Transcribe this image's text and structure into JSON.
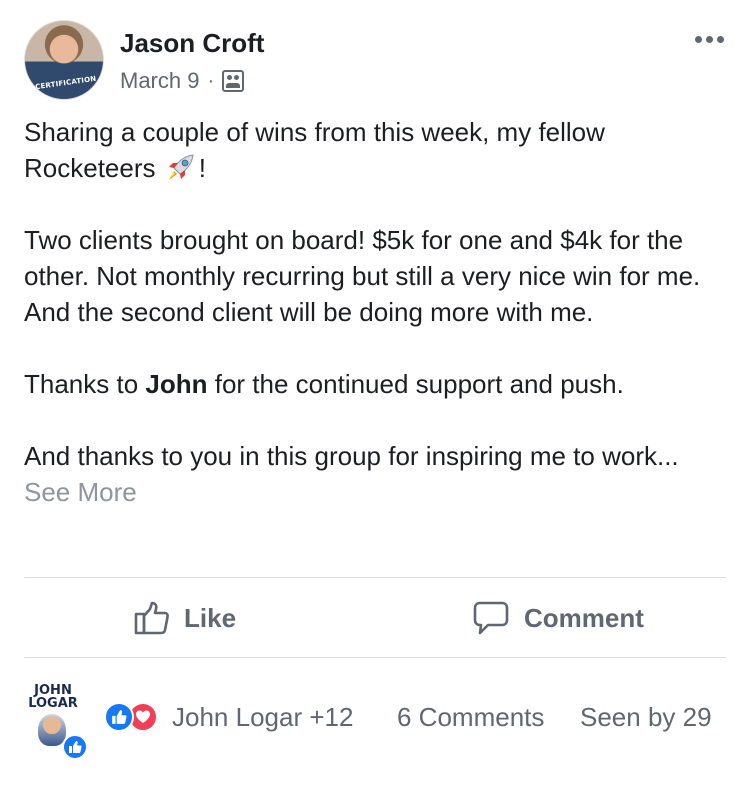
{
  "post": {
    "author": "Jason Croft",
    "date": "March 9",
    "separator": "·",
    "avatar_shirt_text": "CERTIFICATION",
    "body": {
      "line1": "Sharing a couple of wins from this week, my fellow",
      "line2_text": "Rocketeers",
      "line2_after": "!",
      "para2": "Two clients brought on board!  $5k for one and $4k for the other. Not monthly recurring but still a very nice win for me. And the second client will be doing more with me.",
      "para3_before": "Thanks to ",
      "para3_mention": "John",
      "para3_after": " for the continued support and push.",
      "para4": "And thanks to you in this group for inspiring me to work...",
      "see_more": "See More"
    }
  },
  "actions": {
    "like_label": "Like",
    "comment_label": "Comment"
  },
  "footer": {
    "liker_logo_line1": "JOHN",
    "liker_logo_line2": "LOGAR",
    "reactors": "John Logar +12",
    "comments": "6 Comments",
    "seen_by": "Seen by 29"
  },
  "icons": {
    "more": "more-horizontal-icon",
    "audience": "group-audience-icon",
    "rocket": "rocket-emoji",
    "like": "thumbs-up-outline-icon",
    "comment": "speech-bubble-icon",
    "reaction_like": "like-reaction-icon",
    "reaction_love": "love-reaction-icon"
  },
  "colors": {
    "text_primary": "#1c1e21",
    "text_secondary": "#606770",
    "see_more": "#90949c",
    "like_blue": "#1877f2",
    "love_red": "#f33e58",
    "divider": "#dadde1"
  }
}
